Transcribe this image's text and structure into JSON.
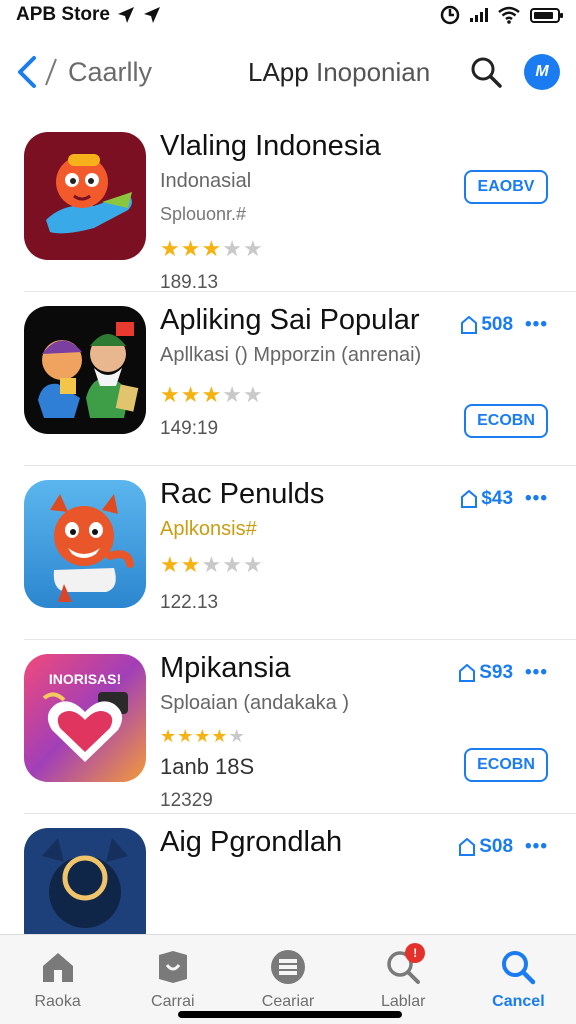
{
  "status": {
    "carrier": "APB Store",
    "battery_level": 0.85
  },
  "nav": {
    "back_label": "Caarlly",
    "title_bold": "LApp",
    "title_rest": "Inoponian",
    "avatar_text": "M"
  },
  "apps": [
    {
      "name": "Vlaling Indonesia",
      "subtitle": "Indonasial",
      "subtitle2": "Splouonr.#",
      "rating": 3,
      "meta": "189.13",
      "button": "EAOBV"
    },
    {
      "name": "Apliking Sai Popular",
      "subtitle": "Apllkasi () Mpporzin (anrenai)",
      "rating": 3,
      "meta": "149:19",
      "price": "508",
      "button": "ECOBN"
    },
    {
      "name": "Rac Penulds",
      "subtitle": "Aplkonsis#",
      "rating": 2,
      "meta": "122.13",
      "price": "$43"
    },
    {
      "name": "Mpikansia",
      "subtitle": "Sploaian (andakaka )",
      "rating": 4,
      "meta2": "1anb 18S",
      "meta": "12329",
      "price": "S93",
      "button": "ECOBN",
      "icon_text": "INORISAS!"
    },
    {
      "name": "Aig Pgrondlah",
      "price": "S08"
    }
  ],
  "tabs": [
    {
      "label": "Raoka",
      "icon": "home-icon"
    },
    {
      "label": "Carrai",
      "icon": "apps-icon"
    },
    {
      "label": "Ceariar",
      "icon": "games-icon"
    },
    {
      "label": "Lablar",
      "icon": "search-badge-icon",
      "badge": "!"
    },
    {
      "label": "Cancel",
      "icon": "search-icon",
      "active": true
    }
  ],
  "colors": {
    "accent": "#1a7cf0",
    "star": "#f5b313",
    "badge": "#e5312b"
  }
}
